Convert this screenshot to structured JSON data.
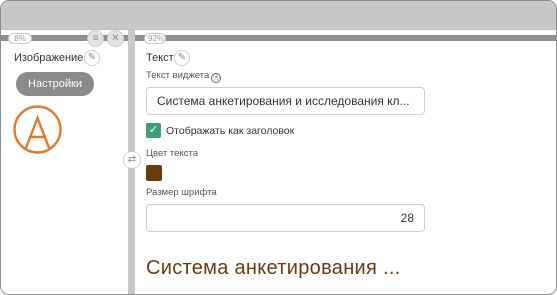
{
  "left_panel": {
    "percent": "8%",
    "label": "Изображение",
    "settings_button": "Настройки",
    "logo_color": "#e07a2c"
  },
  "right_panel": {
    "percent": "92%",
    "title": "Текст",
    "widget_text_label": "Текст виджета",
    "widget_text_value": "Система анкетирования и исследования кл...",
    "show_as_heading_label": "Отображать как заголовок",
    "show_as_heading_checked": true,
    "text_color_label": "Цвет текста",
    "text_color": "#6b3a0e",
    "font_size_label": "Размер шрифта",
    "font_size_value": "28",
    "preview_heading": "Система анкетирования ..."
  },
  "icons": {
    "info": "ⓐ",
    "check": "✓",
    "list": "≡",
    "close": "✕",
    "edit": "✎",
    "swap": "⇄"
  },
  "colors": {
    "accent_green": "#3c9f76",
    "button_gray": "#8a8a8a"
  }
}
